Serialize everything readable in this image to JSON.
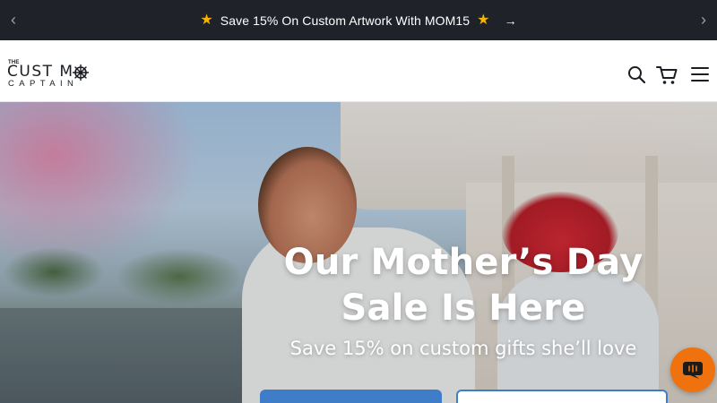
{
  "announcement": {
    "text": "Save 15% On Custom Artwork With MOM15",
    "prev_icon": "‹",
    "next_icon": "›",
    "star_icon": "★",
    "go_icon": "→"
  },
  "header": {
    "logo": {
      "the": "THE",
      "custom": "CUST M",
      "captain": "CAPTAIN"
    },
    "icons": [
      "search-icon",
      "cart-icon",
      "menu-icon"
    ]
  },
  "hero": {
    "headline_line1": "Our Mother’s Day",
    "headline_line2": "Sale Is Here",
    "subheadline": "Save 15% on custom gifts she’ll love"
  },
  "colors": {
    "announcement_bg": "#1f2329",
    "star": "#f5b400",
    "primary_button": "#3f7dc8",
    "chat_button": "#f0720e"
  }
}
